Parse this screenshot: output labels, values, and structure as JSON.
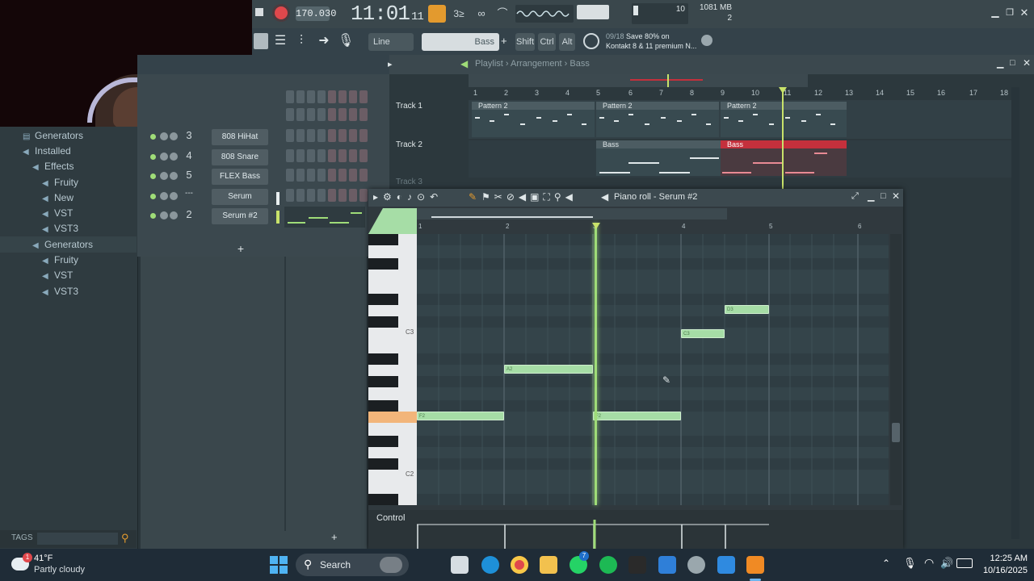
{
  "transport": {
    "tempo": "170.030",
    "time": "11:01",
    "time_small": "11",
    "cpu": "10",
    "memory": "1081 MB",
    "voices": "2",
    "snap": "Line",
    "channel_select": "Bass",
    "shift_label": "Shift",
    "ctrl_label": "Ctrl",
    "alt_label": "Alt",
    "news_counter": "09/18",
    "news_line1": "Save 80% on",
    "news_line2": "Kontakt 8 & 11 premium N..."
  },
  "browser": {
    "items": [
      {
        "label": "Generators"
      },
      {
        "label": "Installed"
      },
      {
        "label": "Effects"
      },
      {
        "label": "Fruity"
      },
      {
        "label": "New"
      },
      {
        "label": "VST"
      },
      {
        "label": "VST3"
      },
      {
        "label": "Generators"
      },
      {
        "label": "Fruity"
      },
      {
        "label": "VST"
      },
      {
        "label": "VST3"
      }
    ],
    "tags_label": "TAGS"
  },
  "channel_rack": {
    "channels": [
      {
        "num": "3",
        "name": "808 HiHat"
      },
      {
        "num": "4",
        "name": "808 Snare"
      },
      {
        "num": "5",
        "name": "FLEX Bass"
      },
      {
        "num": "---",
        "name": "Serum"
      },
      {
        "num": "2",
        "name": "Serum #2"
      }
    ],
    "add_label": "+"
  },
  "playlist": {
    "breadcrumb": [
      "Playlist",
      "Arrangement",
      "Bass"
    ],
    "ruler": [
      "1",
      "2",
      "3",
      "4",
      "5",
      "6",
      "7",
      "8",
      "9",
      "10",
      "11",
      "12",
      "13",
      "14",
      "15",
      "16",
      "17",
      "18"
    ],
    "tracks": [
      "Track 1",
      "Track 2",
      "Track 3"
    ],
    "clips": [
      {
        "label": "Pattern 2"
      },
      {
        "label": "Pattern 2"
      },
      {
        "label": "Pattern 2"
      },
      {
        "label": "Bass"
      },
      {
        "label": "Bass"
      }
    ]
  },
  "piano_roll": {
    "title": "Piano roll - Serum #2",
    "ruler": [
      "1",
      "2",
      "3",
      "4",
      "5",
      "6"
    ],
    "key_labels": [
      "C3",
      "C2"
    ],
    "notes": [
      {
        "label": "F2"
      },
      {
        "label": "A2"
      },
      {
        "label": "F2"
      },
      {
        "label": "C3"
      },
      {
        "label": "D3"
      }
    ],
    "control_label": "Control"
  },
  "taskbar": {
    "weather_temp": "41°F",
    "weather_desc": "Partly cloudy",
    "weather_badge": "1",
    "search_label": "Search",
    "time": "12:25 AM",
    "date": "10/16/2025",
    "whatsapp_badge": "7"
  },
  "colors": {
    "accent_green": "#9fdc78",
    "note_green": "#a6dda6",
    "clip_red": "#c4303c",
    "record_red": "#e0484c",
    "key_highlight": "#f2b57a"
  }
}
